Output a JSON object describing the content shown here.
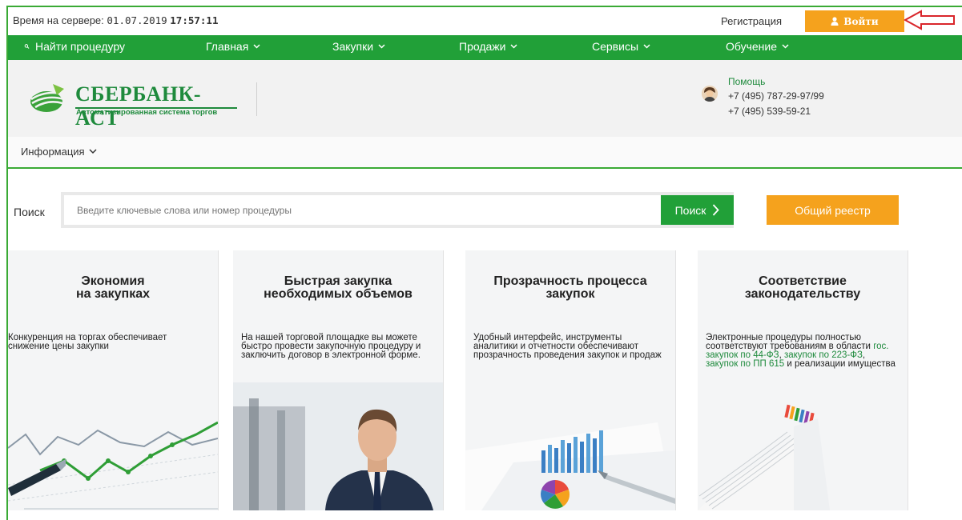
{
  "topbar": {
    "server_time_label": "Время на сервере:",
    "server_date": "01.07.2019",
    "server_time": "17:57:11",
    "registration_label": "Регистрация",
    "login_label": "Войти"
  },
  "nav": {
    "items": [
      {
        "label": "Найти процедуру"
      },
      {
        "label": "Главная"
      },
      {
        "label": "Закупки"
      },
      {
        "label": "Продажи"
      },
      {
        "label": "Сервисы"
      },
      {
        "label": "Обучение"
      }
    ]
  },
  "header": {
    "logo_text": "СБЕРБАНК-АСТ",
    "logo_subtitle": "Автоматизированная система торгов",
    "help_title": "Помощь",
    "phone1": "+7 (495) 787-29-97/99",
    "phone2": "+7 (495) 539-59-21"
  },
  "infobar": {
    "menu_label": "Информация"
  },
  "search": {
    "label": "Поиск",
    "placeholder": "Введите ключевые слова или номер процедуры",
    "button_label": "Поиск",
    "registry_label": "Общий реестр"
  },
  "cards": [
    {
      "title_line1": "Экономия",
      "title_line2": "на закупках",
      "text": "Конкуренция на торгах обеспечивает снижение цены закупки"
    },
    {
      "title_line1": "Быстрая закупка",
      "title_line2": "необходимых объемов",
      "text": "На нашей торговой площадке вы можете быстро провести закупочную процедуру и заключить договор в электронной форме."
    },
    {
      "title_line1": "Прозрачность процесса",
      "title_line2": "закупок",
      "text": "Удобный интерфейс, инструменты аналитики и отчетности обеспечивают прозрачность проведения закупок и продаж"
    },
    {
      "title_line1": "Соответствие",
      "title_line2": "законодательству",
      "text_part1": "Электронные процедуры полностью соответствуют требованиям в области ",
      "link1": "гос. закупок по 44-ФЗ",
      "sep1": ", ",
      "link2": "закупок по 223-ФЗ",
      "sep2": ", ",
      "link3": "закупок по ПП 615",
      "text_part2": " и реализации имущества"
    }
  ],
  "colors": {
    "green": "#21a038",
    "orange": "#f5a21d",
    "annotation_arrow": "#d9262b"
  },
  "icons": {
    "login": "user-icon",
    "search": "search-icon",
    "dropdown": "chevron-down-icon",
    "search_button": "chevron-right-icon",
    "annotation": "arrow-left-outline-icon"
  }
}
